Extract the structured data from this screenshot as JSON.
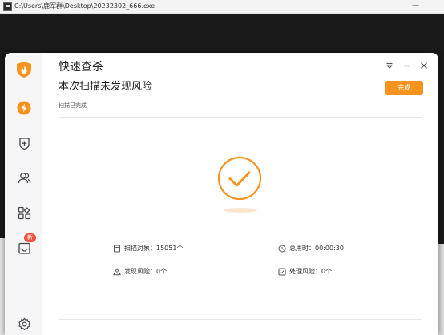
{
  "console": {
    "title": "C:\\Users\\鹿军群\\Desktop\\20232302_666.exe",
    "minimize": "—"
  },
  "app": {
    "title": "快速查杀",
    "heading": "本次扫描未发现风险",
    "subtitle": "扫描已完成",
    "done_label": "完成",
    "accent": "#f7931e"
  },
  "sidebar": {
    "items": [
      {
        "name": "quick-scan",
        "icon": "lightning-icon"
      },
      {
        "name": "protection",
        "icon": "shield-plus-icon"
      },
      {
        "name": "users",
        "icon": "users-icon"
      },
      {
        "name": "apps",
        "icon": "apps-grid-icon"
      },
      {
        "name": "toolbox",
        "icon": "box-icon",
        "badge": "新"
      },
      {
        "name": "settings",
        "icon": "gear-icon"
      }
    ]
  },
  "stats": {
    "scanned": "扫描对象：15051个",
    "time": "总用时：00:00:30",
    "found": "发现风险：0个",
    "handled": "处理风险：0个"
  }
}
